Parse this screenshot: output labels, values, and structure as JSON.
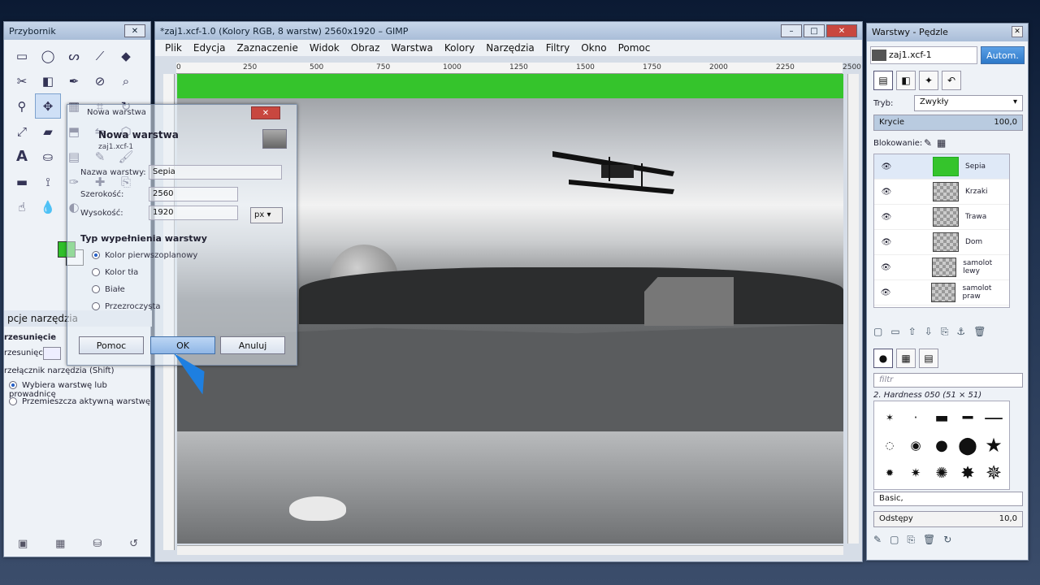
{
  "toolbox": {
    "title": "Przybornik",
    "options_title": "pcje narzędzia",
    "move_header": "rzesunięcie",
    "move_label": "rzesunięcie:",
    "switch_label": "rzełącznik narzędzia  (Shift)",
    "radio1": "Wybiera warstwę lub prowadnicę",
    "radio2": "Przemieszcza aktywną warstwę"
  },
  "image_window": {
    "title": "*zaj1.xcf-1.0 (Kolory RGB, 8 warstw) 2560x1920 – GIMP",
    "menu": [
      "Plik",
      "Edycja",
      "Zaznaczenie",
      "Widok",
      "Obraz",
      "Warstwa",
      "Kolory",
      "Narzędzia",
      "Filtry",
      "Okno",
      "Pomoc"
    ],
    "ruler_ticks": [
      "0",
      "250",
      "500",
      "750",
      "1000",
      "1250",
      "1500",
      "1750",
      "2000",
      "2250",
      "2500"
    ]
  },
  "dialog": {
    "window_title": "Nowa warstwa",
    "heading": "Nowa warstwa",
    "subheading": "zaj1.xcf-1",
    "name_label": "Nazwa warstwy:",
    "name_value": "Sepia",
    "width_label": "Szerokość:",
    "width_value": "2560",
    "height_label": "Wysokość:",
    "height_value": "1920",
    "unit": "px",
    "fill_section": "Typ wypełnienia warstwy",
    "fill_options": [
      "Kolor pierwszoplanowy",
      "Kolor tła",
      "Białe",
      "Przezroczysta"
    ],
    "help_button": "Pomoc",
    "ok_button": "OK",
    "cancel_button": "Anuluj"
  },
  "dock": {
    "title": "Warstwy - Pędzle",
    "image_select": "zaj1.xcf-1",
    "auto_button": "Autom.",
    "mode_label": "Tryb:",
    "mode_value": "Zwykły",
    "opacity_label": "Krycie",
    "opacity_value": "100,0",
    "lock_label": "Blokowanie:",
    "layers": [
      "Sepia",
      "Krzaki",
      "Trawa",
      "Dom",
      "samolot lewy",
      "samolot praw"
    ],
    "filter_placeholder": "filtr",
    "brush_name": "2. Hardness 050 (51 × 51)",
    "brush_preset": "Basic,",
    "spacing_label": "Odstępy",
    "spacing_value": "10,0"
  },
  "colors": {
    "foreground": "#2fc02a",
    "background": "#ffffff",
    "accent": "#2d78c8"
  }
}
